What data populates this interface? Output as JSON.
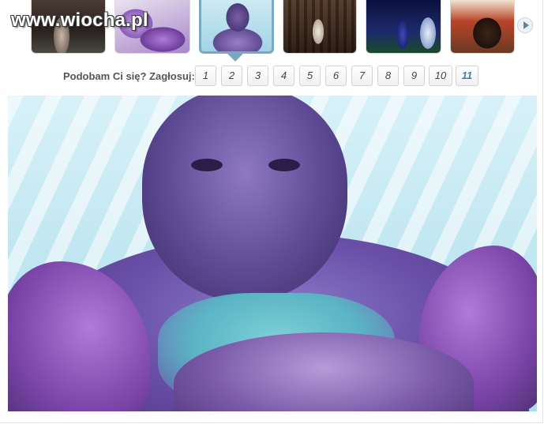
{
  "logo": {
    "text": "www.wiocha.pl"
  },
  "thumbnails": [
    {
      "name": "thumb-1",
      "active": false
    },
    {
      "name": "thumb-2",
      "active": false
    },
    {
      "name": "thumb-3",
      "active": true
    },
    {
      "name": "thumb-4",
      "active": false
    },
    {
      "name": "thumb-5",
      "active": false
    },
    {
      "name": "thumb-6",
      "active": false
    }
  ],
  "nav": {
    "next_icon": "play-right-icon"
  },
  "vote": {
    "label": "Podobam Ci się? Zagłosuj:",
    "options": [
      "1",
      "2",
      "3",
      "4",
      "5",
      "6",
      "7",
      "8",
      "9",
      "10",
      "11"
    ]
  },
  "colors": {
    "accent": "#7aa8bf",
    "vote_highlight": "#3f7ea8"
  }
}
